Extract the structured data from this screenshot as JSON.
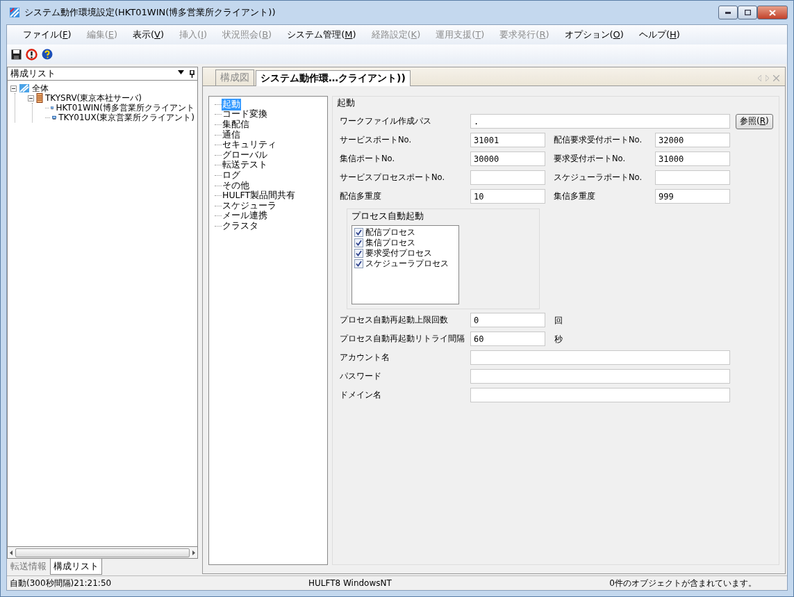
{
  "window": {
    "title": "システム動作環境設定(HKT01WIN(博多営業所クライアント))"
  },
  "menu": [
    {
      "label": "ファイル(F)",
      "disabled": false
    },
    {
      "label": "編集(E)",
      "disabled": true
    },
    {
      "label": "表示(V)",
      "disabled": false
    },
    {
      "label": "挿入(I)",
      "disabled": true
    },
    {
      "label": "状況照会(B)",
      "disabled": true
    },
    {
      "label": "システム管理(M)",
      "disabled": false
    },
    {
      "label": "経路設定(K)",
      "disabled": true
    },
    {
      "label": "運用支援(T)",
      "disabled": true
    },
    {
      "label": "要求発行(R)",
      "disabled": true
    },
    {
      "label": "オプション(O)",
      "disabled": false
    },
    {
      "label": "ヘルプ(H)",
      "disabled": false
    }
  ],
  "left_pane": {
    "title": "構成リスト",
    "tree": [
      {
        "label": "全体",
        "kind": "root",
        "expanded": true,
        "children": [
          {
            "label": "TKYSRV(東京本社サーバ)",
            "kind": "server",
            "expanded": true,
            "children": [
              {
                "label": "HKT01WIN(博多営業所クライアント",
                "kind": "client"
              },
              {
                "label": "TKY01UX(東京営業所クライアント)",
                "kind": "client"
              }
            ]
          }
        ]
      }
    ],
    "tabs": [
      {
        "label": "転送情報",
        "selected": false
      },
      {
        "label": "構成リスト",
        "selected": true
      }
    ]
  },
  "doc_tabs": [
    {
      "label": "構成図",
      "selected": false
    },
    {
      "label": "システム動作環…クライアント))",
      "selected": true
    }
  ],
  "settings_tree": [
    {
      "label": "起動",
      "selected": true
    },
    {
      "label": "コード変換",
      "selected": false
    },
    {
      "label": "集配信",
      "selected": false
    },
    {
      "label": "通信",
      "selected": false
    },
    {
      "label": "セキュリティ",
      "selected": false
    },
    {
      "label": "グローバル",
      "selected": false
    },
    {
      "label": "転送テスト",
      "selected": false
    },
    {
      "label": "ログ",
      "selected": false
    },
    {
      "label": "その他",
      "selected": false
    },
    {
      "label": "HULFT製品間共有",
      "selected": false
    },
    {
      "label": "スケジューラ",
      "selected": false
    },
    {
      "label": "メール連携",
      "selected": false
    },
    {
      "label": "クラスタ",
      "selected": false
    }
  ],
  "form": {
    "title": "起動",
    "path": {
      "label": "ワークファイル作成パス",
      "value": ".",
      "button": "参照(R)"
    },
    "pairs": [
      [
        {
          "label": "サービスポートNo.",
          "value": "31001"
        },
        {
          "label": "配信要求受付ポートNo.",
          "value": "32000"
        }
      ],
      [
        {
          "label": "集信ポートNo.",
          "value": "30000"
        },
        {
          "label": "要求受付ポートNo.",
          "value": "31000"
        }
      ],
      [
        {
          "label": "サービスプロセスポートNo."
        },
        {
          "label": "スケジューラポートNo."
        }
      ],
      [
        {
          "label": "配信多重度",
          "value": "10"
        },
        {
          "label": "集信多重度",
          "value": "999"
        }
      ]
    ],
    "auto_start": {
      "title": "プロセス自動起動",
      "items": [
        {
          "label": "配信プロセス",
          "checked": true
        },
        {
          "label": "集信プロセス",
          "checked": true
        },
        {
          "label": "要求受付プロセス",
          "checked": true
        },
        {
          "label": "スケジューラプロセス",
          "checked": true
        }
      ]
    },
    "units": [
      {
        "label": "プロセス自動再起動上限回数",
        "value": "0",
        "unit": "回"
      },
      {
        "label": "プロセス自動再起動リトライ間隔",
        "value": "60",
        "unit": "秒"
      }
    ],
    "wide": [
      {
        "label": "アカウント名"
      },
      {
        "label": "パスワード"
      },
      {
        "label": "ドメイン名"
      }
    ]
  },
  "status_bar": {
    "left": "自動(300秒間隔)21:21:50",
    "center": "HULFT8 WindowsNT",
    "right": "0件のオブジェクトが含まれています。"
  }
}
